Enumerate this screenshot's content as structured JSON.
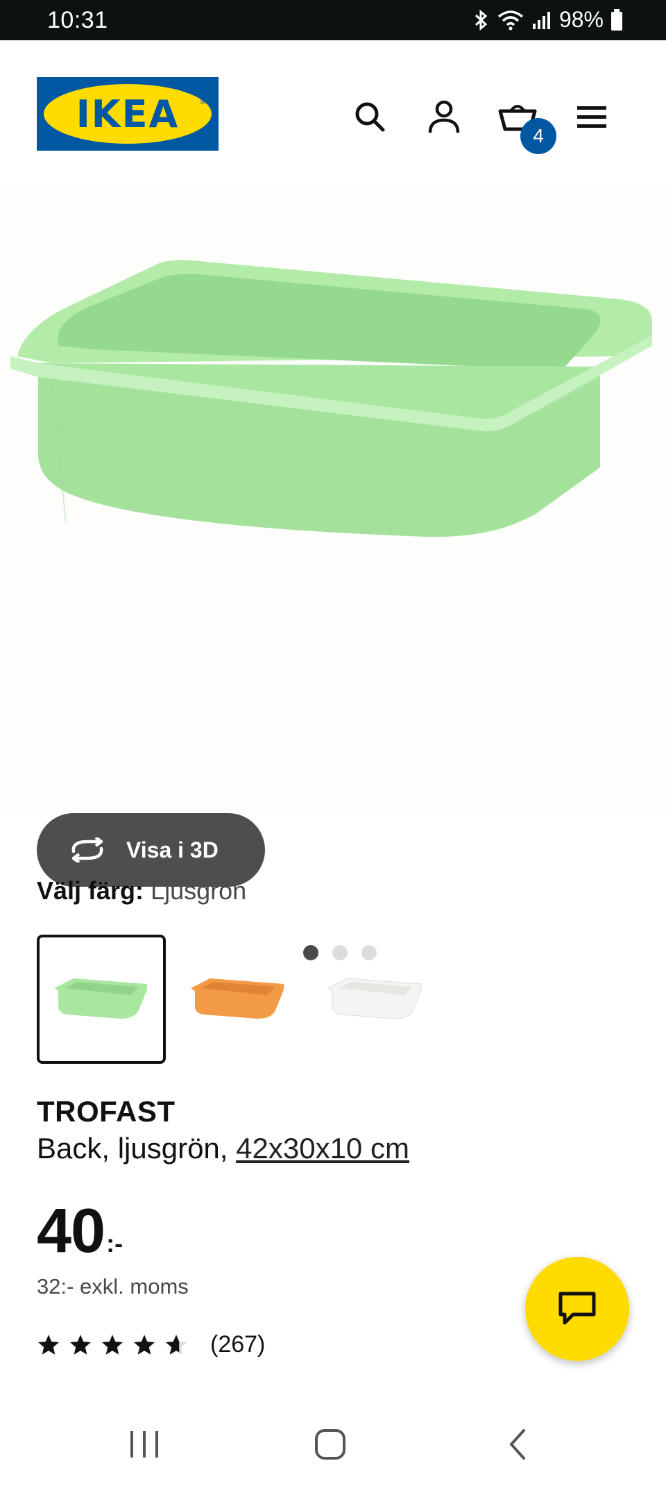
{
  "status_bar": {
    "time": "10:31",
    "battery": "98%"
  },
  "header": {
    "logo_text": "IKEA",
    "logo_reg": "®",
    "cart_count": "4",
    "icons": [
      "search-icon",
      "profile-icon",
      "cart-icon",
      "menu-icon"
    ]
  },
  "gallery": {
    "view_3d_label": "Visa i 3D",
    "dots": [
      true,
      false,
      false
    ]
  },
  "color_chooser": {
    "label": "Välj färg:",
    "selected_value": "Ljusgrön",
    "options": [
      {
        "color": "#a6e6a0",
        "selected": true
      },
      {
        "color": "#f29a45",
        "selected": false
      },
      {
        "color": "#f4f4f2",
        "selected": false
      }
    ]
  },
  "product": {
    "name": "TROFAST",
    "description": "Back, ljusgrön, ",
    "dimensions": "42x30x10 cm",
    "price": "40",
    "price_suffix": ":-",
    "price_ex_vat": "32:- exkl. moms",
    "rating_stars": 4.5,
    "rating_count": "(267)"
  },
  "colors": {
    "ikea_blue": "#0058a3",
    "ikea_yellow": "#ffdb00",
    "bin_green": "#a6e6a0"
  }
}
